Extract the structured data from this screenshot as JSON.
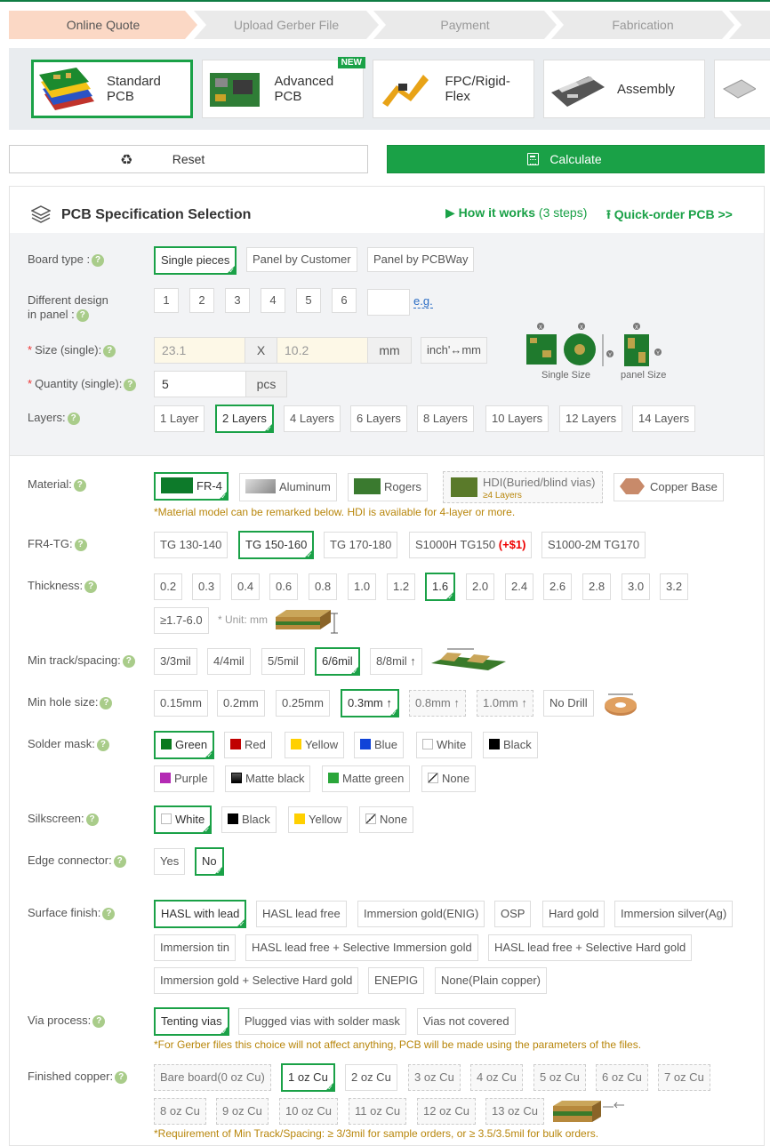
{
  "steps": [
    "Online Quote",
    "Upload Gerber File",
    "Payment",
    "Fabrication"
  ],
  "products": [
    {
      "label": "Standard PCB"
    },
    {
      "label": "Advanced PCB",
      "badge": "NEW"
    },
    {
      "label": "FPC/Rigid-Flex"
    },
    {
      "label": "Assembly"
    }
  ],
  "actions": {
    "reset": "Reset",
    "calculate": "Calculate"
  },
  "panel": {
    "title": "PCB Specification Selection",
    "how": "How it works",
    "how_steps": "(3 steps)",
    "quick": "Quick-order PCB >>"
  },
  "board_type": {
    "label": "Board type :",
    "options": [
      "Single pieces",
      "Panel by Customer",
      "Panel by PCBWay"
    ],
    "selected": "Single pieces"
  },
  "design": {
    "label1": "Different design",
    "label2": "in panel :",
    "options": [
      "1",
      "2",
      "3",
      "4",
      "5",
      "6"
    ],
    "eg": "e.g."
  },
  "size": {
    "label": "Size (single):",
    "x_value": "23.1",
    "y_value": "10.2",
    "x_sep": "X",
    "unit": "mm",
    "convert": "inch'↔mm",
    "single_caption": "Single Size",
    "panel_caption": "panel Size"
  },
  "quantity": {
    "label": "Quantity (single):",
    "value": "5",
    "unit": "pcs"
  },
  "layers": {
    "label": "Layers:",
    "options": [
      "1 Layer",
      "2 Layers",
      "4 Layers",
      "6 Layers",
      "8 Layers",
      "10 Layers",
      "12 Layers",
      "14 Layers"
    ],
    "selected": "2 Layers"
  },
  "material": {
    "label": "Material:",
    "options": [
      "FR-4",
      "Aluminum",
      "Rogers",
      "HDI(Buried/blind vias)",
      "Copper Base"
    ],
    "hdi_sub": "≥4 Layers",
    "selected": "FR-4",
    "note": "*Material model can be remarked below. HDI is available for 4-layer or more."
  },
  "fr4tg": {
    "label": "FR4-TG:",
    "options": [
      "TG 130-140",
      "TG 150-160",
      "TG 170-180",
      "S1000H TG150",
      "S1000-2M TG170"
    ],
    "surcharge": "(+$1)",
    "selected": "TG 150-160"
  },
  "thickness": {
    "label": "Thickness:",
    "options": [
      "0.2",
      "0.3",
      "0.4",
      "0.6",
      "0.8",
      "1.0",
      "1.2",
      "1.6",
      "2.0",
      "2.4",
      "2.6",
      "2.8",
      "3.0",
      "3.2",
      "≥1.7-6.0"
    ],
    "selected": "1.6",
    "unit_note": "* Unit: mm"
  },
  "track": {
    "label": "Min track/spacing:",
    "options": [
      "3/3mil",
      "4/4mil",
      "5/5mil",
      "6/6mil",
      "8/8mil ↑"
    ],
    "selected": "6/6mil"
  },
  "hole": {
    "label": "Min hole size:",
    "options": [
      "0.15mm",
      "0.2mm",
      "0.25mm",
      "0.3mm ↑",
      "0.8mm ↑",
      "1.0mm ↑",
      "No Drill"
    ],
    "selected": "0.3mm ↑"
  },
  "solder": {
    "label": "Solder mask:",
    "options": [
      {
        "name": "Green",
        "color": "#0a7a1e"
      },
      {
        "name": "Red",
        "color": "#c00000"
      },
      {
        "name": "Yellow",
        "color": "#ffd000"
      },
      {
        "name": "Blue",
        "color": "#1043d8"
      },
      {
        "name": "White",
        "color": "#ffffff"
      },
      {
        "name": "Black",
        "color": "#000000"
      },
      {
        "name": "Purple",
        "color": "#b42ab4"
      },
      {
        "name": "Matte black",
        "color": "#1a1a1a"
      },
      {
        "name": "Matte green",
        "color": "#2aa63a"
      },
      {
        "name": "None",
        "color": "none"
      }
    ],
    "selected": "Green"
  },
  "silk": {
    "label": "Silkscreen:",
    "options": [
      {
        "name": "White",
        "color": "#ffffff"
      },
      {
        "name": "Black",
        "color": "#000000"
      },
      {
        "name": "Yellow",
        "color": "#ffd000"
      },
      {
        "name": "None",
        "color": "none"
      }
    ],
    "selected": "White"
  },
  "edge": {
    "label": "Edge connector:",
    "options": [
      "Yes",
      "No"
    ],
    "selected": "No"
  },
  "finish": {
    "label": "Surface finish:",
    "options": [
      "HASL with lead",
      "HASL lead free",
      "Immersion gold(ENIG)",
      "OSP",
      "Hard gold",
      "Immersion silver(Ag)",
      "Immersion tin",
      "HASL lead free + Selective Immersion gold",
      "HASL lead free + Selective Hard gold",
      "Immersion gold + Selective Hard gold",
      "ENEPIG",
      "None(Plain copper)"
    ],
    "selected": "HASL with lead"
  },
  "via": {
    "label": "Via process:",
    "options": [
      "Tenting vias",
      "Plugged vias with solder mask",
      "Vias not covered"
    ],
    "selected": "Tenting vias",
    "note": "*For Gerber files this choice will not affect anything, PCB will be made using the parameters of the files."
  },
  "copper": {
    "label": "Finished copper:",
    "options": [
      "Bare board(0 oz Cu)",
      "1 oz Cu",
      "2 oz Cu",
      "3 oz Cu",
      "4 oz Cu",
      "5 oz Cu",
      "6 oz Cu",
      "7 oz Cu",
      "8 oz Cu",
      "9 oz Cu",
      "10 oz Cu",
      "11 oz Cu",
      "12 oz Cu",
      "13 oz Cu"
    ],
    "selected": "1 oz Cu",
    "note": "*Requirement of Min Track/Spacing: ≥ 3/3mil for sample orders, or ≥ 3.5/3.5mil for bulk orders."
  },
  "colors": {
    "accent": "#1aa147",
    "step_active": "#fbd8c5",
    "note": "#b8860b"
  }
}
